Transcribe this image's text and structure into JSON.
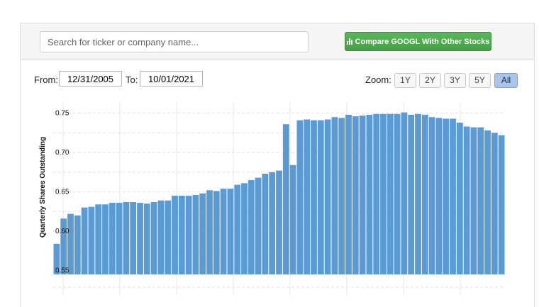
{
  "search": {
    "placeholder": "Search for ticker or company name..."
  },
  "compare_button": {
    "label": "Compare GOOGL With Other Stocks",
    "icon": "bar-chart-icon",
    "color": "#4aa84a"
  },
  "date_range": {
    "from_label": "From:",
    "from_value": "12/31/2005",
    "to_label": "To:",
    "to_value": "10/01/2021"
  },
  "zoom": {
    "label": "Zoom:",
    "options": [
      "1Y",
      "2Y",
      "3Y",
      "5Y",
      "All"
    ],
    "selected": "All"
  },
  "chart_data": {
    "type": "bar",
    "ylabel": "Quarterly Shares Outstanding",
    "xlabel": "",
    "ylim": [
      0.545,
      0.765
    ],
    "yticks": [
      0.55,
      0.6,
      0.65,
      0.7,
      0.75
    ],
    "ytick_labels": [
      "0.55",
      "0.60",
      "0.65",
      "0.70",
      "0.75"
    ],
    "grid": true,
    "bar_color": "#5b9bd5",
    "values": [
      0.584,
      0.616,
      0.622,
      0.62,
      0.63,
      0.631,
      0.634,
      0.634,
      0.636,
      0.636,
      0.637,
      0.637,
      0.636,
      0.635,
      0.637,
      0.639,
      0.639,
      0.645,
      0.645,
      0.645,
      0.646,
      0.648,
      0.652,
      0.651,
      0.654,
      0.654,
      0.659,
      0.661,
      0.665,
      0.668,
      0.673,
      0.675,
      0.677,
      0.736,
      0.684,
      0.741,
      0.742,
      0.741,
      0.741,
      0.742,
      0.745,
      0.744,
      0.748,
      0.746,
      0.747,
      0.748,
      0.749,
      0.749,
      0.749,
      0.749,
      0.751,
      0.748,
      0.749,
      0.748,
      0.745,
      0.744,
      0.743,
      0.743,
      0.738,
      0.733,
      0.732,
      0.732,
      0.728,
      0.725,
      0.722
    ]
  }
}
